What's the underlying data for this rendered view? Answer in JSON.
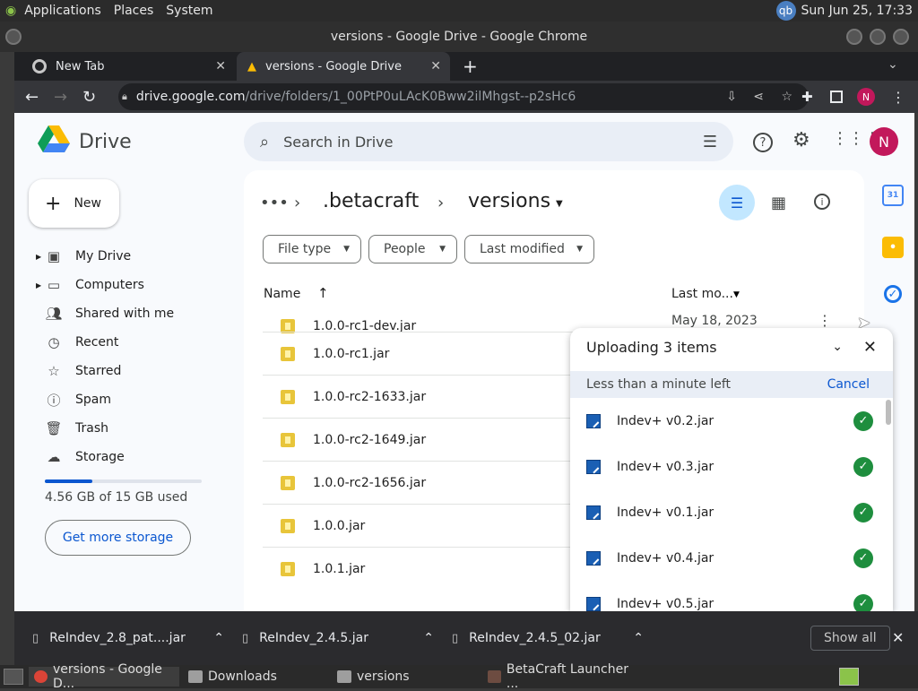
{
  "system_panel": {
    "menus": [
      "Applications",
      "Places",
      "System"
    ],
    "clock": "Sun Jun 25, 17:33",
    "tray_badge": "qb"
  },
  "window": {
    "title": "versions - Google Drive - Google Chrome"
  },
  "browser": {
    "tabs": [
      {
        "label": "New Tab",
        "active": false
      },
      {
        "label": "versions - Google Drive",
        "active": true
      }
    ],
    "url_domain": "drive.google.com",
    "url_path": "/drive/folders/1_00PtP0uLAcK0Bww2ilMhgst--p2sHc6",
    "profile_initial": "N"
  },
  "drive": {
    "app_name": "Drive",
    "search_placeholder": "Search in Drive",
    "profile_initial": "N",
    "new_label": "New",
    "nav": [
      {
        "label": "My Drive",
        "icon": "my-drive-icon"
      },
      {
        "label": "Computers",
        "icon": "computers-icon"
      },
      {
        "label": "Shared with me",
        "icon": "shared-icon"
      },
      {
        "label": "Recent",
        "icon": "clock-icon"
      },
      {
        "label": "Starred",
        "icon": "star-icon"
      },
      {
        "label": "Spam",
        "icon": "spam-icon"
      },
      {
        "label": "Trash",
        "icon": "trash-icon"
      },
      {
        "label": "Storage",
        "icon": "cloud-icon"
      }
    ],
    "storage_used_fraction": 0.304,
    "storage_text": "4.56 GB of 15 GB used",
    "get_more_storage": "Get more storage",
    "breadcrumb_parent": ".betacraft",
    "breadcrumb_current": "versions",
    "filters": [
      "File type",
      "People",
      "Last modified"
    ],
    "columns": {
      "name": "Name",
      "modified": "Last mo..."
    },
    "first_row_date": "May 18, 2023",
    "files": [
      "1.0.0-rc1-dev.jar",
      "1.0.0-rc1.jar",
      "1.0.0-rc2-1633.jar",
      "1.0.0-rc2-1649.jar",
      "1.0.0-rc2-1656.jar",
      "1.0.0.jar",
      "1.0.1.jar"
    ]
  },
  "upload": {
    "title": "Uploading 3 items",
    "status": "Less than a minute left",
    "cancel": "Cancel",
    "items": [
      "Indev+ v0.2.jar",
      "Indev+ v0.3.jar",
      "Indev+ v0.1.jar",
      "Indev+ v0.4.jar",
      "Indev+ v0.5.jar"
    ]
  },
  "downloads": {
    "items": [
      "ReIndev_2.8_pat....jar",
      "ReIndev_2.4.5.jar",
      "ReIndev_2.4.5_02.jar"
    ],
    "show_all": "Show all"
  },
  "taskbar": {
    "items": [
      "versions - Google D...",
      "Downloads",
      "versions",
      "BetaCraft Launcher ..."
    ]
  },
  "colors": {
    "accent": "#0b57d0",
    "check_green": "#1e8e3e",
    "chrome_dark": "#202124"
  }
}
